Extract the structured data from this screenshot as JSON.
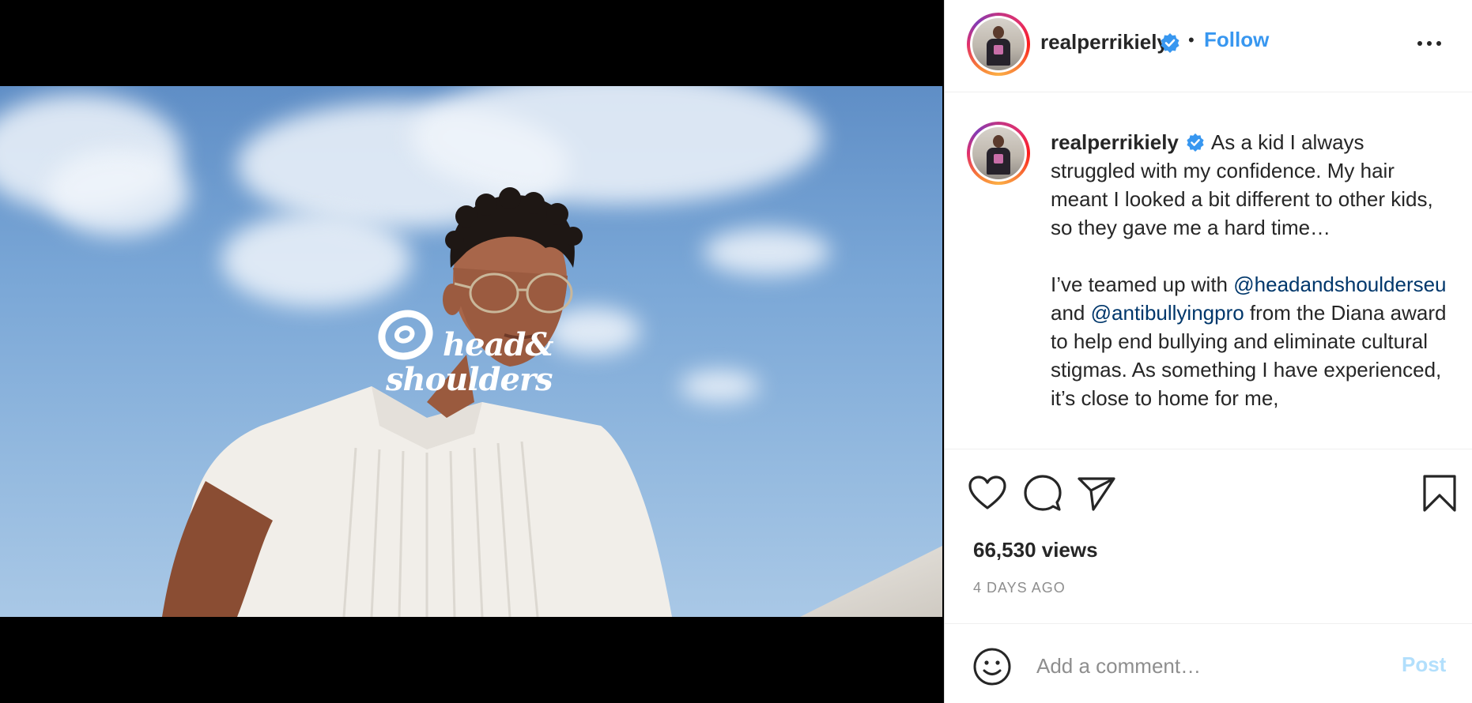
{
  "media": {
    "brand_line1": "head&",
    "brand_line2": "shoulders",
    "colors": {
      "letterbox": "#000000",
      "sky": "#79a6d6"
    }
  },
  "header": {
    "username": "realperrikiely",
    "verified": true,
    "separator": "•",
    "follow_label": "Follow",
    "more_icon": "more-horizontal-icon"
  },
  "caption": {
    "username": "realperrikiely",
    "paragraph1": "As a kid I always struggled with my confidence. My hair meant I looked a bit different to other kids, so they gave me a hard time…",
    "paragraph2_start": "I’ve teamed up with",
    "mention1": "@headandshoulderseu",
    "between_mentions": "and",
    "mention2": "@antibullyingpro",
    "paragraph2_end": "from the Diana award to help end bullying and eliminate cultural stigmas. As something I have experienced, it’s close to home for me,"
  },
  "actions": {
    "icons": [
      "heart-icon",
      "comment-icon",
      "share-icon",
      "bookmark-icon"
    ],
    "views": "66,530 views",
    "timestamp": "4 DAYS AGO"
  },
  "comment_box": {
    "placeholder": "Add a comment…",
    "post_label": "Post",
    "emoji_icon": "emoji-icon"
  },
  "colors": {
    "link": "#3897f0",
    "mention": "#00376b",
    "text": "#262626",
    "muted": "#8e8e8e",
    "post_disabled": "#b2dffc"
  }
}
